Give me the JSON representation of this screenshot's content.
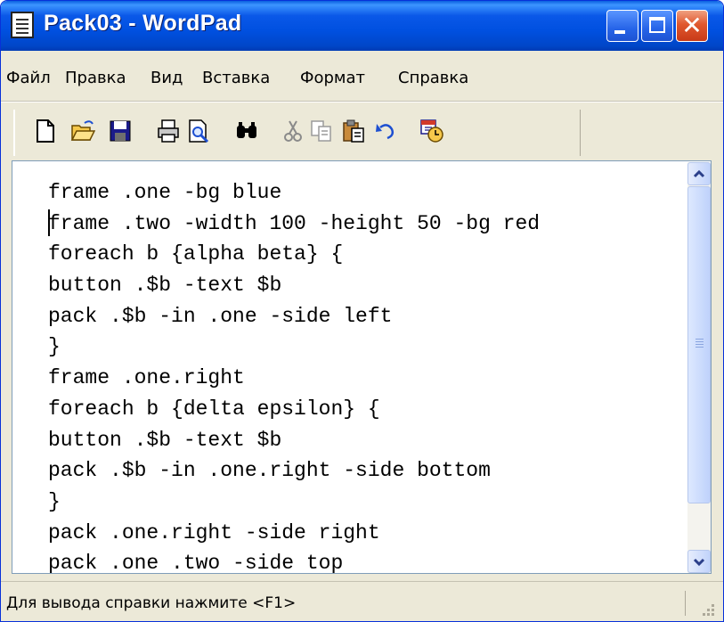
{
  "window": {
    "title": "Pack03 - WordPad",
    "titlebar_color": "#0054e3",
    "close_color": "#e0582e"
  },
  "menu": {
    "items": [
      {
        "label": "Файл"
      },
      {
        "label": "Правка"
      },
      {
        "label": "Вид"
      },
      {
        "label": "Вставка"
      },
      {
        "label": "Формат"
      },
      {
        "label": "Справка"
      }
    ]
  },
  "toolbar": {
    "buttons": [
      "new-icon",
      "open-icon",
      "save-icon",
      "print-icon",
      "print-preview-icon",
      "find-icon",
      "cut-icon",
      "copy-icon",
      "paste-icon",
      "undo-icon",
      "insert-date-time-icon"
    ]
  },
  "document": {
    "lines": [
      "frame .one -bg blue",
      "frame .two -width 100 -height 50 -bg red",
      "foreach b {alpha beta} {",
      "button .$b -text $b",
      "pack .$b -in .one -side left",
      "}",
      "frame .one.right",
      "foreach b {delta epsilon} {",
      "button .$b -text $b",
      "pack .$b -in .one.right -side bottom",
      "}",
      "pack .one.right -side right",
      "pack .one .two -side top"
    ]
  },
  "status": {
    "text": "Для вывода справки нажмите <F1>"
  }
}
